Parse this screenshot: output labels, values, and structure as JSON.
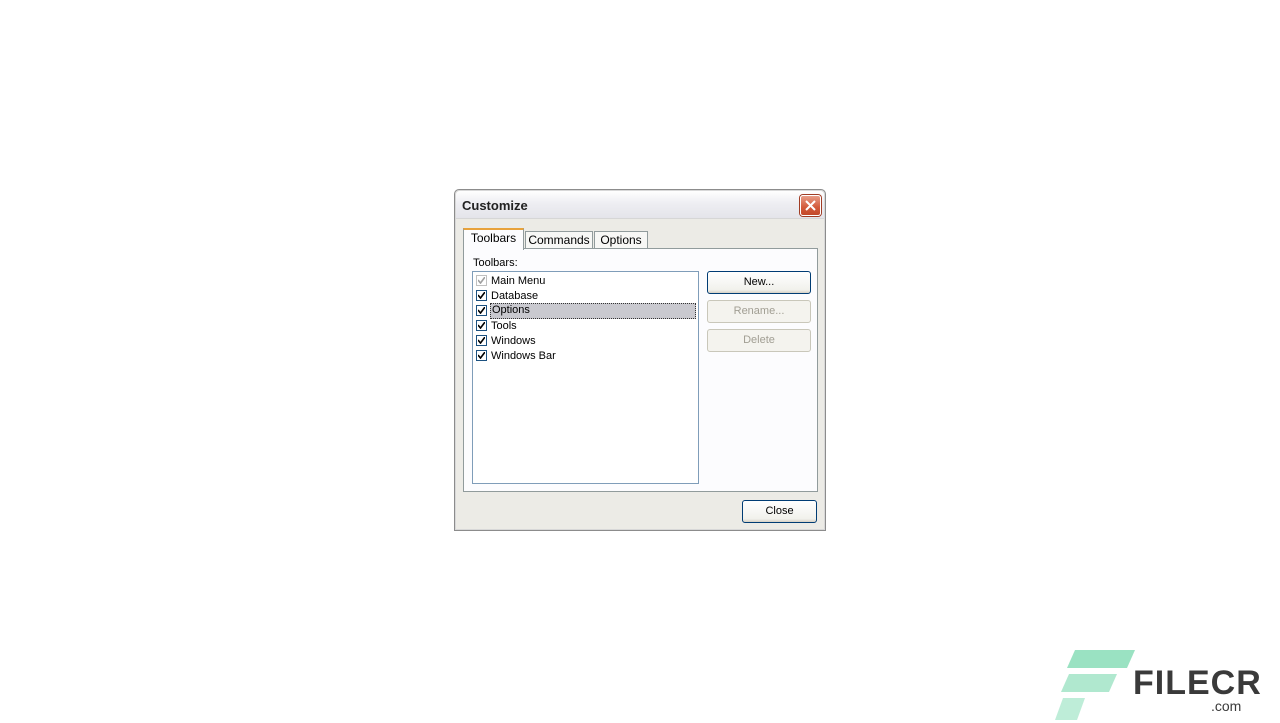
{
  "dialog": {
    "title": "Customize",
    "tabs": [
      {
        "label": "Toolbars",
        "active": true
      },
      {
        "label": "Commands",
        "active": false
      },
      {
        "label": "Options",
        "active": false
      }
    ],
    "toolbars_label": "Toolbars:",
    "toolbars": [
      {
        "label": "Main Menu",
        "checked": true,
        "disabled": true,
        "selected": false
      },
      {
        "label": "Database",
        "checked": true,
        "disabled": false,
        "selected": false
      },
      {
        "label": "Options",
        "checked": true,
        "disabled": false,
        "selected": true
      },
      {
        "label": "Tools",
        "checked": true,
        "disabled": false,
        "selected": false
      },
      {
        "label": "Windows",
        "checked": true,
        "disabled": false,
        "selected": false
      },
      {
        "label": "Windows Bar",
        "checked": true,
        "disabled": false,
        "selected": false
      }
    ],
    "buttons": {
      "new": {
        "label": "New...",
        "enabled": true
      },
      "rename": {
        "label": "Rename...",
        "enabled": false
      },
      "delete": {
        "label": "Delete",
        "enabled": false
      },
      "close": {
        "label": "Close"
      }
    }
  },
  "watermark": {
    "brand": "FILECR",
    "suffix": ".com"
  },
  "colors": {
    "accent_tab": "#e8a23a",
    "close_button": "#d35a3a",
    "watermark_green": "#6fd6a8"
  }
}
